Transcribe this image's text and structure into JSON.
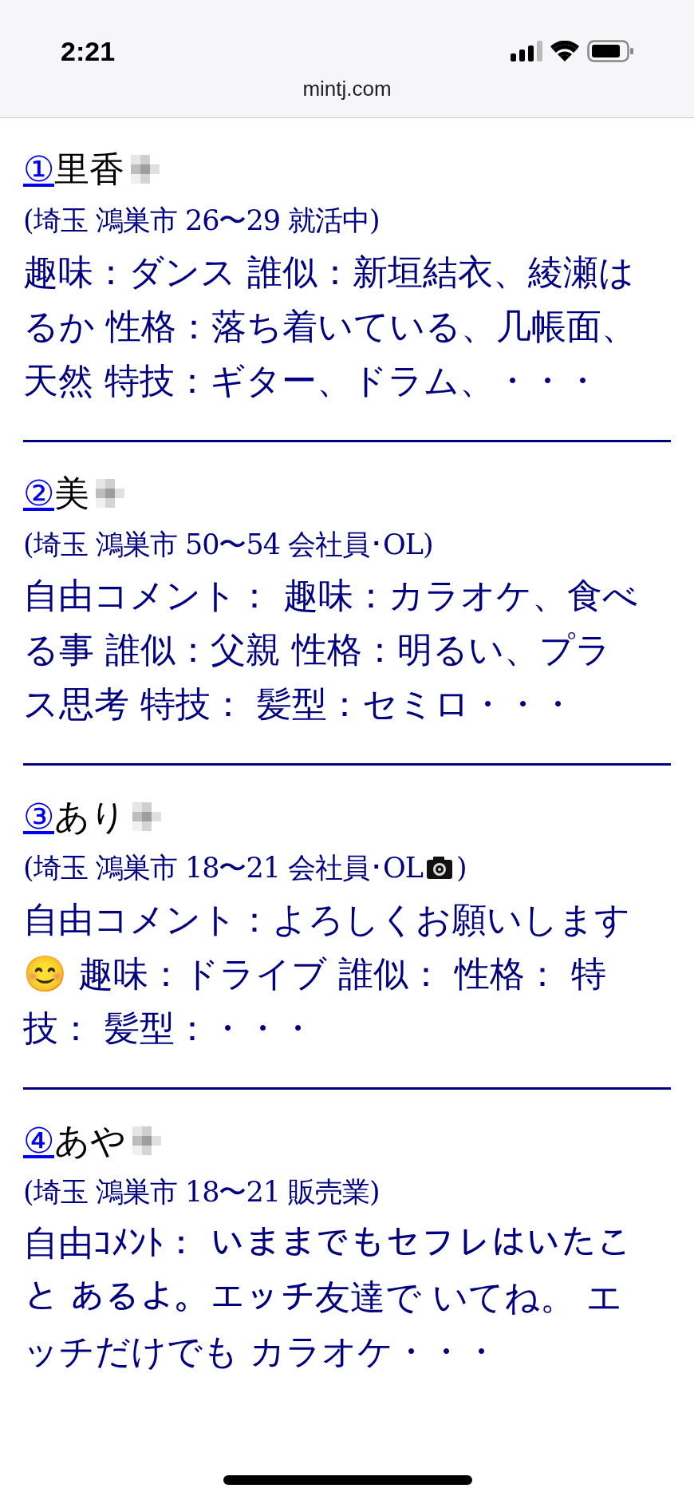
{
  "status_bar": {
    "time": "2:21"
  },
  "address_bar": {
    "url": "mintj.com"
  },
  "entries": [
    {
      "number": "①",
      "name": "里香",
      "details": [
        {
          "kind": "text",
          "text": "(埼玉 鴻巣市 26〜29 就活中)"
        }
      ],
      "profile": "趣味：ダンス 誰似：新垣結衣、綾瀬はるか 性格：落ち着いている、几帳面、天然 特技：ギター、ドラム、・・・"
    },
    {
      "number": "②",
      "name": "美",
      "details": [
        {
          "kind": "text",
          "text": "(埼玉 鴻巣市 50〜54 会社員･OL)"
        }
      ],
      "profile": "自由コメント： 趣味：カラオケ、食べる事 誰似：父親 性格：明るい、プラス思考 特技： 髪型：セミロ・・・"
    },
    {
      "number": "③",
      "name": "あり",
      "details": [
        {
          "kind": "text",
          "text": "(埼玉 鴻巣市 18〜21 会社員･OL"
        },
        {
          "kind": "camera"
        },
        {
          "kind": "text",
          "text": ")"
        }
      ],
      "profile": "自由コメント：よろしくお願いします😊 趣味：ドライブ 誰似： 性格： 特技： 髪型：・・・"
    },
    {
      "number": "④",
      "name": "あや",
      "details": [
        {
          "kind": "text",
          "text": "(埼玉 鴻巣市 18〜21 販売業)"
        }
      ],
      "profile": "自由ｺﾒﾝﾄ： いままでもセフレはいたこと あるよ。エッチ友達で いてね。 エッチだけでも カラオケ・・・"
    }
  ]
}
